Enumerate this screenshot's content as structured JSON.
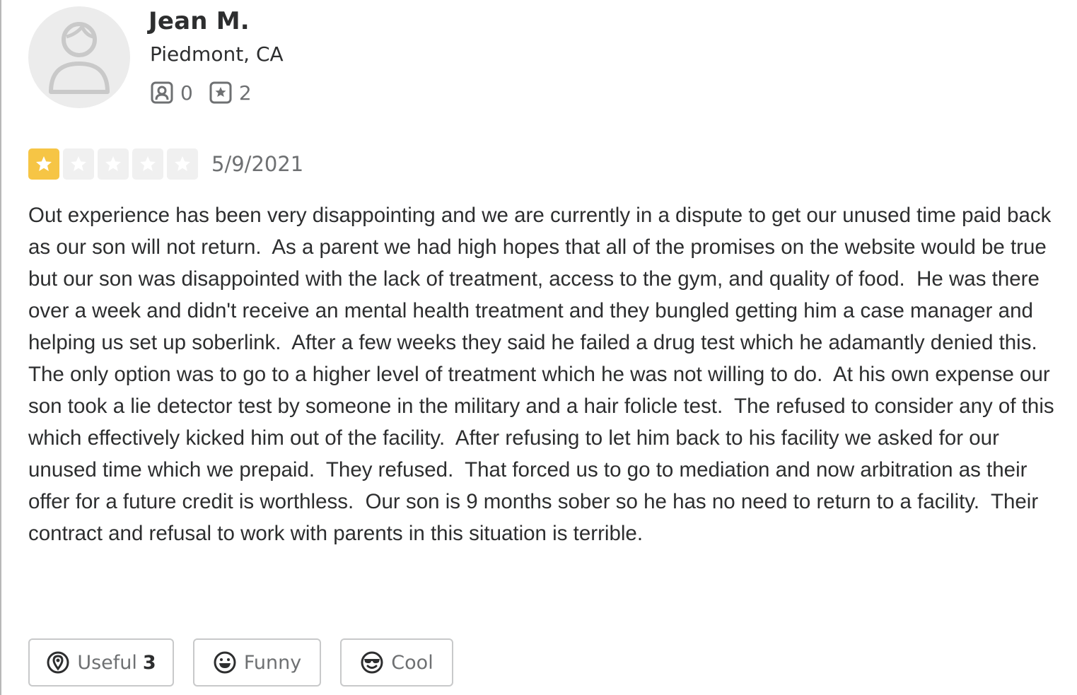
{
  "user": {
    "name": "Jean M.",
    "location": "Piedmont, CA",
    "friends_count": "0",
    "reviews_count": "2"
  },
  "review": {
    "rating": 1,
    "max_rating": 5,
    "date": "5/9/2021",
    "text": "Out experience has been very disappointing and we are currently in a dispute to get our unused time paid back as our son will not return.  As a parent we had high hopes that all of the promises on the website would be true but our son was disappointed with the lack of treatment, access to the gym, and quality of food.  He was there over a week and didn't receive an mental health treatment and they bungled getting him a case manager and helping us set up soberlink.  After a few weeks they said he failed a drug test which he adamantly denied this.  The only option was to go to a higher level of treatment which he was not willing to do.  At his own expense our son took a lie detector test by someone in the military and a hair folicle test.  The refused to consider any of this which effectively kicked him out of the facility.  After refusing to let him back to his facility we asked for our unused time which we prepaid.  They refused.  That forced us to go to mediation and now arbitration as their offer for a future credit is worthless.  Our son is 9 months sober so he has no need to return to a facility.  Their contract and refusal to work with parents in this situation is terrible."
  },
  "reactions": {
    "useful_label": "Useful",
    "useful_count": "3",
    "funny_label": "Funny",
    "cool_label": "Cool"
  },
  "colors": {
    "star_on": "#f6c545",
    "star_off": "#f0f0f0",
    "text": "#2d2e2f",
    "muted": "#6e7072"
  }
}
